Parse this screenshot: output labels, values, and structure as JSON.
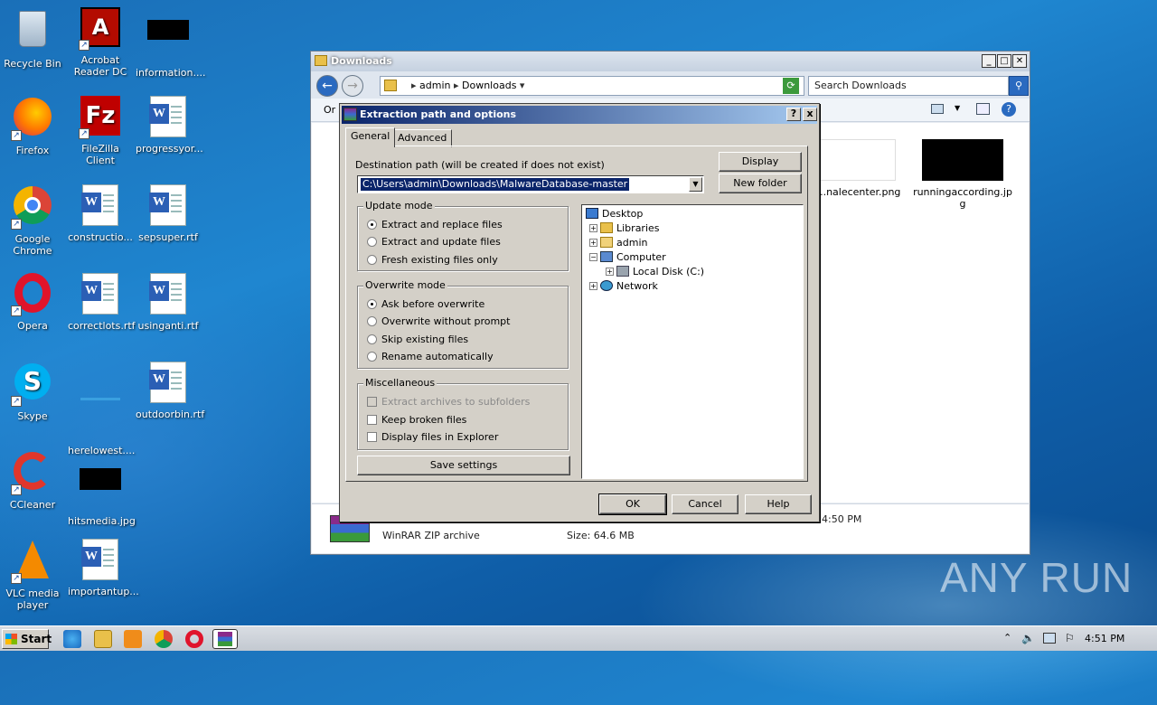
{
  "desktop": {
    "icons": [
      {
        "label": "Recycle Bin"
      },
      {
        "label": "Acrobat Reader DC"
      },
      {
        "label": "information...."
      },
      {
        "label": "Firefox"
      },
      {
        "label": "FileZilla Client"
      },
      {
        "label": "progressyor..."
      },
      {
        "label": "Google Chrome"
      },
      {
        "label": "constructio..."
      },
      {
        "label": "sepsuper.rtf"
      },
      {
        "label": "Opera"
      },
      {
        "label": "correctlots.rtf"
      },
      {
        "label": "usinganti.rtf"
      },
      {
        "label": "Skype"
      },
      {
        "label": "herelowest...."
      },
      {
        "label": "outdoorbin.rtf"
      },
      {
        "label": "CCleaner"
      },
      {
        "label": "hitsmedia.jpg"
      },
      {
        "label": "VLC media player"
      },
      {
        "label": "importantup..."
      }
    ]
  },
  "explorer": {
    "title": "Downloads",
    "breadcrumb": [
      "admin",
      "Downloads"
    ],
    "search_placeholder": "Search Downloads",
    "organize_label": "Or",
    "files": [
      {
        "name": "...nalecenter.png"
      },
      {
        "name": "runningaccording.jpg"
      }
    ],
    "details": {
      "type": "WinRAR ZIP archive",
      "size": "Size: 64.6 MB",
      "time": "4:50 PM"
    }
  },
  "dialog": {
    "title": "Extraction path and options",
    "help_button": "?",
    "close_button": "x",
    "tabs": [
      "General",
      "Advanced"
    ],
    "dest_label": "Destination path (will be created if does not exist)",
    "dest_value": "C:\\Users\\admin\\Downloads\\MalwareDatabase-master",
    "display_button": "Display",
    "new_folder_button": "New folder",
    "update_mode": {
      "title": "Update mode",
      "options": [
        "Extract and replace files",
        "Extract and update files",
        "Fresh existing files only"
      ],
      "selected": 0
    },
    "overwrite_mode": {
      "title": "Overwrite mode",
      "options": [
        "Ask before overwrite",
        "Overwrite without prompt",
        "Skip existing files",
        "Rename automatically"
      ],
      "selected": 0
    },
    "misc": {
      "title": "Miscellaneous",
      "options": [
        "Extract archives to subfolders",
        "Keep broken files",
        "Display files in Explorer"
      ]
    },
    "save_settings": "Save settings",
    "tree": {
      "desktop": "Desktop",
      "libraries": "Libraries",
      "admin": "admin",
      "computer": "Computer",
      "local_disk": "Local Disk (C:)",
      "network": "Network"
    },
    "ok": "OK",
    "cancel": "Cancel",
    "help": "Help"
  },
  "taskbar": {
    "start": "Start",
    "time": "4:51 PM"
  },
  "watermark": "ANY RUN"
}
